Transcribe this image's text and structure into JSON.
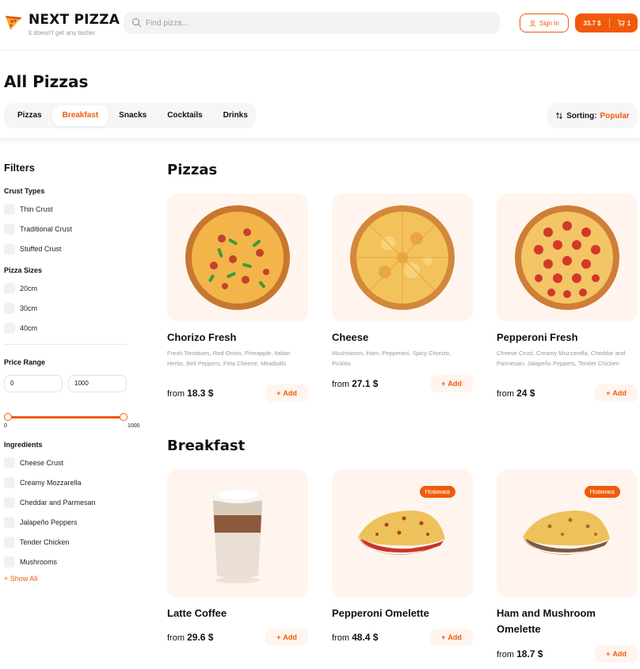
{
  "header": {
    "brand_name": "NEXT PIZZA",
    "brand_tagline": "it doesn't get any tastier",
    "search_placeholder": "Find pizza...",
    "signin_label": "Sign In",
    "cart_total": "33.7 $",
    "cart_count": "1"
  },
  "page_title": "All Pizzas",
  "categories": {
    "tabs": [
      "Pizzas",
      "Breakfast",
      "Snacks",
      "Cocktails",
      "Drinks"
    ],
    "active": "Breakfast"
  },
  "sorting": {
    "label": "Sorting:",
    "value": "Popular"
  },
  "filters": {
    "title": "Filters",
    "crust_title": "Crust Types",
    "crust": [
      "Thin Crust",
      "Traditional Crust",
      "Stuffed Crust"
    ],
    "sizes_title": "Pizza Sizes",
    "sizes": [
      "20cm",
      "30cm",
      "40cm"
    ],
    "price_title": "Price Range",
    "price_from": "0",
    "price_to": "1000",
    "slider_min": "0",
    "slider_max": "1000",
    "ingredients_title": "Ingredients",
    "ingredients": [
      "Cheese Crust",
      "Creamy Mozzarella",
      "Cheddar and Parmesan",
      "Jalapeño Peppers",
      "Tender Chicken",
      "Mushrooms"
    ],
    "show_all": "+ Show All"
  },
  "sections": {
    "pizzas": {
      "title": "Pizzas",
      "items": [
        {
          "name": "Chorizo Fresh",
          "desc": "Fresh Tomatoes, Red Onion, Pineapple, Italian Herbs, Bell Peppers, Feta Cheese, Meatballs",
          "price_prefix": "from",
          "price": "18.3 $",
          "add": "Add"
        },
        {
          "name": "Cheese",
          "desc": "Mushrooms, Ham, Pepperoni, Spicy Chorizo, Pickles",
          "price_prefix": "from",
          "price": "27.1 $",
          "add": "Add"
        },
        {
          "name": "Pepperoni Fresh",
          "desc": "Cheese Crust, Creamy Mozzarella, Cheddar and Parmesan, Jalapeño Peppers, Tender Chicken",
          "price_prefix": "from",
          "price": "24 $",
          "add": "Add"
        }
      ]
    },
    "breakfast": {
      "title": "Breakfast",
      "items": [
        {
          "name": "Latte Coffee",
          "price_prefix": "from",
          "price": "29.6 $",
          "add": "Add"
        },
        {
          "name": "Pepperoni Omelette",
          "badge": "Новинка",
          "price_prefix": "from",
          "price": "48.4 $",
          "add": "Add"
        },
        {
          "name": "Ham and Mushroom Omelette",
          "badge": "Новинка",
          "price_prefix": "from",
          "price": "18.7 $",
          "add": "Add"
        }
      ]
    }
  },
  "colors": {
    "accent": "#f15a0a",
    "card_bg": "#fff5ee",
    "muted": "#9a9a9a"
  }
}
